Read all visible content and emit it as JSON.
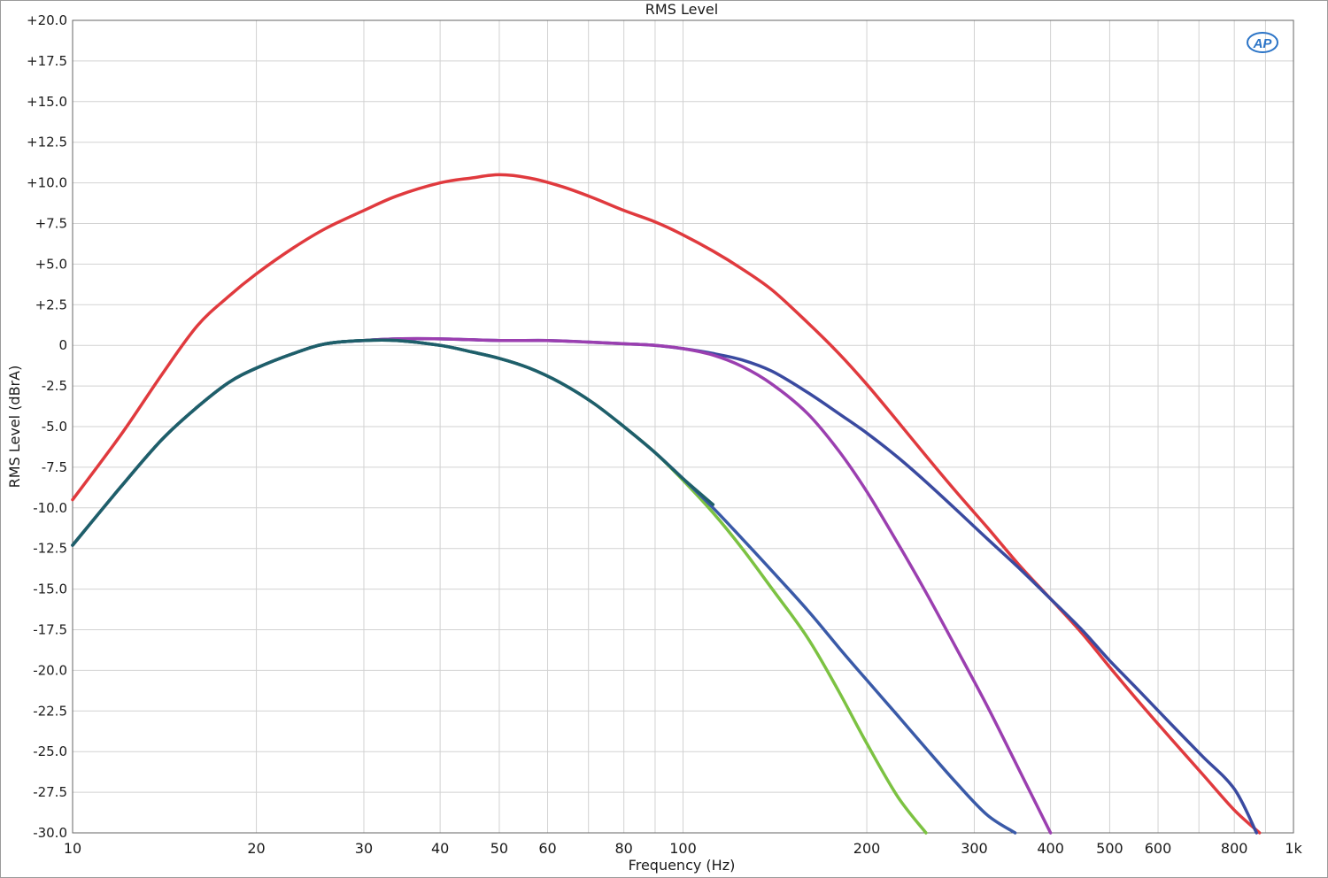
{
  "chart_data": {
    "type": "line",
    "title": "RMS Level",
    "xlabel": "Frequency (Hz)",
    "ylabel": "RMS Level (dBrA)",
    "x_scale": "log",
    "xlim": [
      10,
      1000
    ],
    "ylim": [
      -30,
      20
    ],
    "grid": true,
    "logo_text": "AP",
    "x_ticks": [
      {
        "value": 10,
        "label": "10"
      },
      {
        "value": 20,
        "label": "20"
      },
      {
        "value": 30,
        "label": "30"
      },
      {
        "value": 40,
        "label": "40"
      },
      {
        "value": 50,
        "label": "50"
      },
      {
        "value": 60,
        "label": "60"
      },
      {
        "value": 80,
        "label": "80"
      },
      {
        "value": 100,
        "label": "100"
      },
      {
        "value": 200,
        "label": "200"
      },
      {
        "value": 300,
        "label": "300"
      },
      {
        "value": 400,
        "label": "400"
      },
      {
        "value": 500,
        "label": "500"
      },
      {
        "value": 600,
        "label": "600"
      },
      {
        "value": 800,
        "label": "800"
      },
      {
        "value": 1000,
        "label": "1k"
      }
    ],
    "x_minor_gridlines": [
      70,
      90,
      700,
      900
    ],
    "y_ticks": [
      {
        "value": 20,
        "label": "+20.0"
      },
      {
        "value": 17.5,
        "label": "+17.5"
      },
      {
        "value": 15,
        "label": "+15.0"
      },
      {
        "value": 12.5,
        "label": "+12.5"
      },
      {
        "value": 10,
        "label": "+10.0"
      },
      {
        "value": 7.5,
        "label": "+7.5"
      },
      {
        "value": 5,
        "label": "+5.0"
      },
      {
        "value": 2.5,
        "label": "+2.5"
      },
      {
        "value": 0,
        "label": "0"
      },
      {
        "value": -2.5,
        "label": "-2.5"
      },
      {
        "value": -5,
        "label": "-5.0"
      },
      {
        "value": -7.5,
        "label": "-7.5"
      },
      {
        "value": -10,
        "label": "-10.0"
      },
      {
        "value": -12.5,
        "label": "-12.5"
      },
      {
        "value": -15,
        "label": "-15.0"
      },
      {
        "value": -17.5,
        "label": "-17.5"
      },
      {
        "value": -20,
        "label": "-20.0"
      },
      {
        "value": -22.5,
        "label": "-22.5"
      },
      {
        "value": -25,
        "label": "-25.0"
      },
      {
        "value": -27.5,
        "label": "-27.5"
      },
      {
        "value": -30,
        "label": "-30.0"
      }
    ],
    "series": [
      {
        "color": "#e03a3e",
        "x": [
          10,
          12,
          14,
          16,
          18,
          20,
          23,
          26,
          30,
          34,
          40,
          45,
          50,
          56,
          63,
          71,
          80,
          90,
          100,
          112,
          125,
          140,
          160,
          180,
          200,
          225,
          250,
          280,
          315,
          355,
          400,
          450,
          500,
          560,
          630,
          710,
          800,
          880
        ],
        "y": [
          -9.5,
          -5.5,
          -1.8,
          1.2,
          3.0,
          4.4,
          6.0,
          7.2,
          8.3,
          9.2,
          10.0,
          10.3,
          10.5,
          10.3,
          9.8,
          9.1,
          8.3,
          7.6,
          6.8,
          5.8,
          4.7,
          3.4,
          1.4,
          -0.5,
          -2.4,
          -4.7,
          -6.8,
          -9.0,
          -11.2,
          -13.5,
          -15.6,
          -17.7,
          -19.8,
          -22.0,
          -24.2,
          -26.4,
          -28.6,
          -30.0
        ]
      },
      {
        "color": "#3a4aa0",
        "x": [
          10,
          12,
          14,
          16,
          18,
          20,
          23,
          26,
          30,
          34,
          40,
          50,
          60,
          70,
          80,
          90,
          100,
          112,
          125,
          140,
          160,
          180,
          200,
          225,
          250,
          280,
          315,
          355,
          400,
          450,
          500,
          560,
          630,
          710,
          800,
          870
        ],
        "y": [
          -12.3,
          -8.7,
          -5.8,
          -3.8,
          -2.3,
          -1.4,
          -0.5,
          0.1,
          0.3,
          0.4,
          0.4,
          0.3,
          0.3,
          0.2,
          0.1,
          0.0,
          -0.2,
          -0.5,
          -0.9,
          -1.6,
          -2.9,
          -4.2,
          -5.4,
          -6.9,
          -8.4,
          -10.1,
          -11.9,
          -13.7,
          -15.6,
          -17.5,
          -19.4,
          -21.3,
          -23.3,
          -25.3,
          -27.3,
          -30.0
        ]
      },
      {
        "color": "#9b3fb0",
        "x": [
          10,
          12,
          14,
          16,
          18,
          20,
          23,
          26,
          30,
          34,
          40,
          50,
          60,
          70,
          80,
          90,
          100,
          112,
          125,
          140,
          160,
          180,
          200,
          225,
          250,
          280,
          315,
          355,
          400
        ],
        "y": [
          -12.3,
          -8.7,
          -5.8,
          -3.8,
          -2.3,
          -1.4,
          -0.5,
          0.1,
          0.3,
          0.4,
          0.4,
          0.3,
          0.3,
          0.2,
          0.1,
          0.0,
          -0.2,
          -0.6,
          -1.3,
          -2.4,
          -4.2,
          -6.5,
          -9.0,
          -12.2,
          -15.2,
          -18.6,
          -22.2,
          -26.1,
          -30.0
        ]
      },
      {
        "color": "#7cc242",
        "x": [
          10,
          12,
          14,
          16,
          18,
          20,
          23,
          26,
          30,
          34,
          40,
          45,
          50,
          56,
          63,
          71,
          80,
          90,
          100,
          112,
          125,
          140,
          160,
          180,
          200,
          225,
          250
        ],
        "y": [
          -12.3,
          -8.7,
          -5.8,
          -3.8,
          -2.3,
          -1.4,
          -0.5,
          0.1,
          0.3,
          0.3,
          0.0,
          -0.4,
          -0.8,
          -1.4,
          -2.3,
          -3.5,
          -5.0,
          -6.6,
          -8.3,
          -10.3,
          -12.5,
          -15.0,
          -18.0,
          -21.3,
          -24.5,
          -27.8,
          -30.0
        ]
      },
      {
        "color": "#3a5aa8",
        "x": [
          10,
          12,
          14,
          16,
          18,
          20,
          23,
          26,
          30,
          34,
          40,
          45,
          50,
          56,
          63,
          71,
          80,
          90,
          100,
          112,
          125,
          140,
          160,
          180,
          200,
          225,
          250,
          280,
          315,
          350
        ],
        "y": [
          -12.3,
          -8.7,
          -5.8,
          -3.8,
          -2.3,
          -1.4,
          -0.5,
          0.1,
          0.3,
          0.3,
          0.0,
          -0.4,
          -0.8,
          -1.4,
          -2.3,
          -3.5,
          -5.0,
          -6.6,
          -8.2,
          -10.0,
          -11.9,
          -13.9,
          -16.3,
          -18.6,
          -20.6,
          -22.8,
          -24.8,
          -26.9,
          -28.9,
          -30.0
        ]
      },
      {
        "color": "#1e5f6a",
        "x": [
          10,
          12,
          14,
          16,
          18,
          20,
          23,
          26,
          30,
          34,
          40,
          45,
          50,
          56,
          63,
          71,
          80,
          90,
          100,
          112
        ],
        "y": [
          -12.3,
          -8.7,
          -5.8,
          -3.8,
          -2.3,
          -1.4,
          -0.5,
          0.1,
          0.3,
          0.3,
          0.0,
          -0.4,
          -0.8,
          -1.4,
          -2.3,
          -3.5,
          -5.0,
          -6.6,
          -8.2,
          -9.8
        ]
      }
    ]
  }
}
